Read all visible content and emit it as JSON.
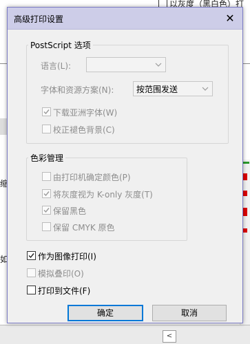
{
  "background": {
    "header_text": "以灰度（黑白色）打",
    "left_fragment": "缩",
    "left_fragment2": "如翻"
  },
  "dialog": {
    "title": "高级打印设置",
    "close_glyph": "✕",
    "postscript": {
      "legend": "PostScript 选项",
      "language_label": "语言(L):",
      "language_value": "",
      "font_label": "字体和资源方案(N):",
      "font_value": "按范围发送",
      "download_asian_fonts": "下载亚洲字体(W)",
      "correct_background": "校正褪色背景(C)"
    },
    "color": {
      "legend": "色彩管理",
      "printer_color": "由打印机确定颜色(P)",
      "gray_as_konly": "将灰度视为 K-only 灰度(T)",
      "keep_black": "保留黑色",
      "keep_cmyk": "保留 CMYK 原色"
    },
    "print_as_image": "作为图像打印(I)",
    "simulate_overprint": "模拟叠印(O)",
    "print_to_file": "打印到文件(F)",
    "ok": "确定",
    "cancel": "取消"
  },
  "states": {
    "download_asian_fonts": true,
    "correct_background": false,
    "printer_color": false,
    "gray_as_konly": true,
    "keep_black": true,
    "keep_cmyk": false,
    "print_as_image": true,
    "simulate_overprint": false,
    "print_to_file": false
  },
  "colors": {
    "title_bar": "#cdcde8",
    "default_button_border": "#0078d7",
    "disabled_text": "#8d8d8d"
  }
}
